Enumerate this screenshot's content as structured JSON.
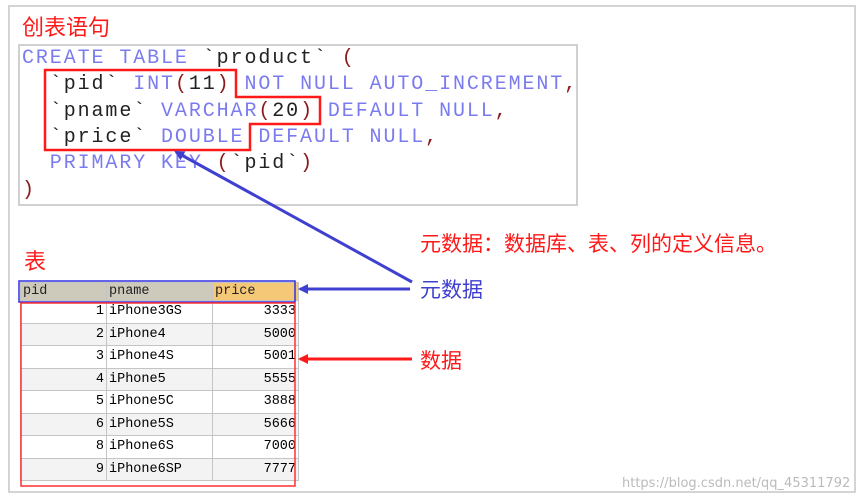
{
  "heading_create": "创表语句",
  "code_lines": [
    [
      [
        "kw",
        "CREATE TABLE "
      ],
      [
        "tx",
        "`product`"
      ],
      [
        "pn",
        " ("
      ]
    ],
    [
      [
        "tx",
        "  `pid` "
      ],
      [
        "kw",
        "INT"
      ],
      [
        "pn",
        "("
      ],
      [
        "tx",
        "11"
      ],
      [
        "pn",
        ")"
      ],
      [
        "kw",
        " NOT NULL AUTO_INCREMENT"
      ],
      [
        "pn",
        ","
      ]
    ],
    [
      [
        "tx",
        "  `pname` "
      ],
      [
        "kw",
        "VARCHAR"
      ],
      [
        "pn",
        "("
      ],
      [
        "tx",
        "20"
      ],
      [
        "pn",
        ")"
      ],
      [
        "kw",
        " DEFAULT NULL"
      ],
      [
        "pn",
        ","
      ]
    ],
    [
      [
        "tx",
        "  `price` "
      ],
      [
        "kw",
        "DOUBLE DEFAULT NULL"
      ],
      [
        "pn",
        ","
      ]
    ],
    [
      [
        "kw",
        "  PRIMARY KEY "
      ],
      [
        "pn",
        "("
      ],
      [
        "tx",
        "`pid`"
      ],
      [
        "pn",
        ")"
      ]
    ],
    [
      [
        "pn",
        ")"
      ]
    ]
  ],
  "heading_table": "表",
  "table": {
    "headers": [
      "pid",
      "pname",
      "price"
    ],
    "rows": [
      [
        "1",
        "iPhone3GS",
        "3333"
      ],
      [
        "2",
        "iPhone4",
        "5000"
      ],
      [
        "3",
        "iPhone4S",
        "5001"
      ],
      [
        "4",
        "iPhone5",
        "5555"
      ],
      [
        "5",
        "iPhone5C",
        "3888"
      ],
      [
        "6",
        "iPhone5S",
        "5666"
      ],
      [
        "8",
        "iPhone6S",
        "7000"
      ],
      [
        "9",
        "iPhone6SP",
        "7777"
      ]
    ]
  },
  "notes": {
    "definition": "元数据：数据库、表、列的定义信息。",
    "metadata": "元数据",
    "data": "数据"
  },
  "watermark": "https://blog.csdn.net/qq_45311792",
  "colors": {
    "red": "#ff1a1a",
    "blue": "#4040d0",
    "keyword": "#7b7bf0"
  }
}
